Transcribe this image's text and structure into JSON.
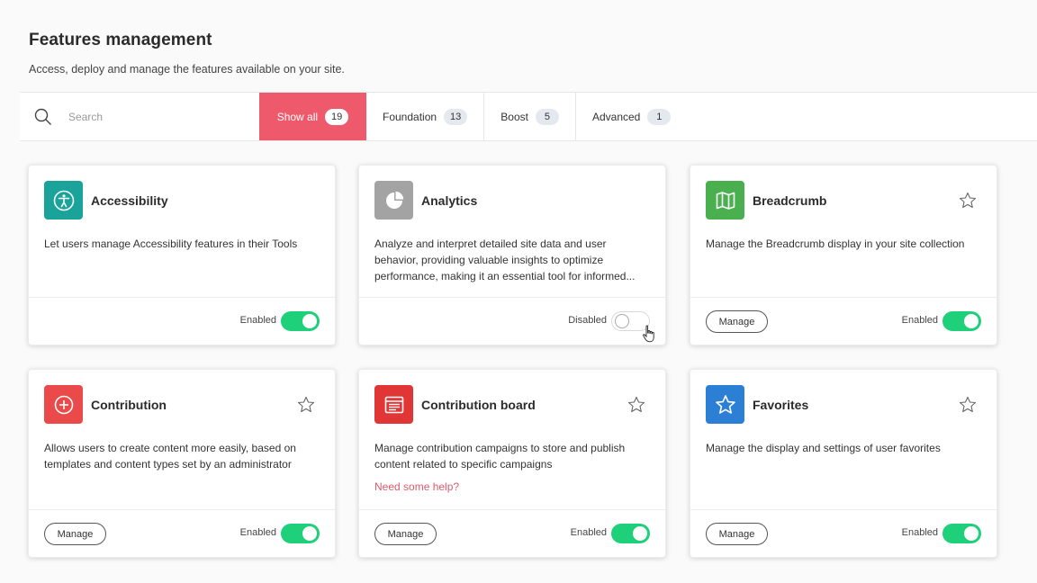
{
  "header": {
    "title": "Features management",
    "subtitle": "Access, deploy and manage the features available on your site."
  },
  "search": {
    "placeholder": "Search"
  },
  "tabs": [
    {
      "label": "Show all",
      "count": "19",
      "active": true
    },
    {
      "label": "Foundation",
      "count": "13"
    },
    {
      "label": "Boost",
      "count": "5"
    },
    {
      "label": "Advanced",
      "count": "1"
    }
  ],
  "colors": {
    "accent": "#ee5a6c",
    "toggle_on": "#1fd07a",
    "accessibility": "#1aa39b",
    "analytics": "#a3a3a3",
    "breadcrumb": "#4ab04f",
    "contribution": "#ea4a4a",
    "contribution_board": "#e03636",
    "favorites": "#2b7fd4"
  },
  "cards": [
    {
      "title": "Accessibility",
      "icon": "accessibility-icon",
      "description": "Let users manage Accessibility features in their Tools",
      "status": "Enabled",
      "enabled": true
    },
    {
      "title": "Analytics",
      "icon": "pie-chart-icon",
      "description": "Analyze and interpret detailed site data and user behavior, providing valuable insights to optimize performance, making it an essential tool for informed...",
      "status": "Disabled",
      "enabled": false
    },
    {
      "title": "Breadcrumb",
      "icon": "map-icon",
      "description": "Manage the Breadcrumb display in your site collection",
      "status": "Enabled",
      "enabled": true,
      "manage_label": "Manage"
    },
    {
      "title": "Contribution",
      "icon": "plus-circle-icon",
      "description": "Allows users to create content more easily, based on templates and content types set by an administrator",
      "status": "Enabled",
      "enabled": true,
      "manage_label": "Manage"
    },
    {
      "title": "Contribution board",
      "icon": "board-icon",
      "description": "Manage contribution campaigns to store and publish content related to specific campaigns",
      "help": "Need some help?",
      "status": "Enabled",
      "enabled": true,
      "manage_label": "Manage"
    },
    {
      "title": "Favorites",
      "icon": "star-icon",
      "description": "Manage the display and settings of user favorites",
      "status": "Enabled",
      "enabled": true,
      "manage_label": "Manage"
    }
  ]
}
